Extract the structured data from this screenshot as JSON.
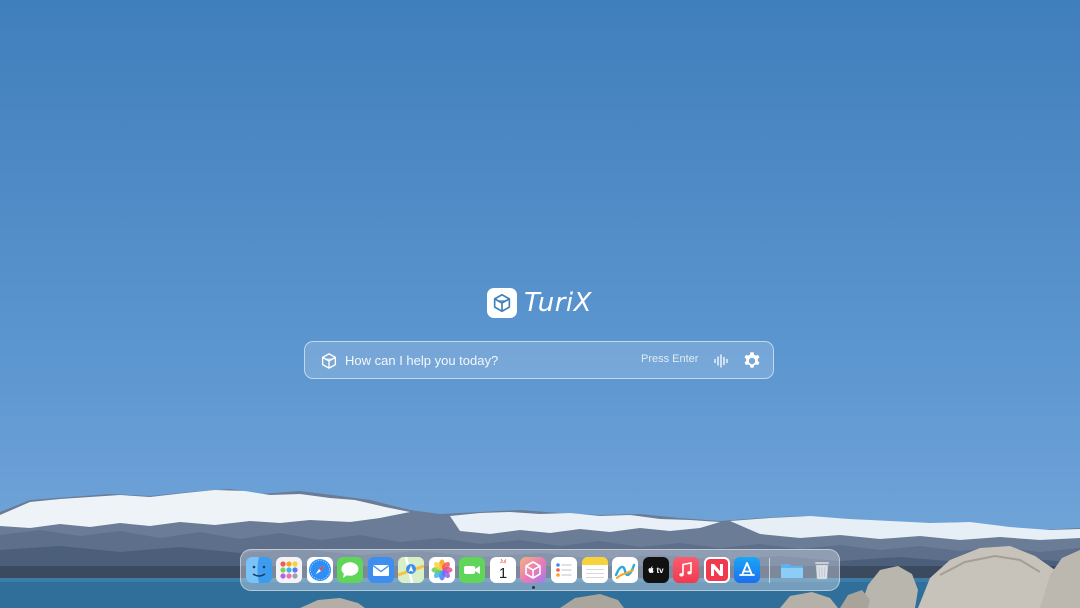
{
  "app": {
    "name": "TuriX"
  },
  "prompt": {
    "placeholder": "How can I help you today?",
    "hint": "Press Enter"
  },
  "dock": {
    "calendar_month": "Jul",
    "calendar_day": "1",
    "appletv_label": "tv",
    "apps": [
      {
        "name": "Finder",
        "icon": "finder-icon"
      },
      {
        "name": "Launchpad",
        "icon": "launchpad-icon"
      },
      {
        "name": "Safari",
        "icon": "safari-icon"
      },
      {
        "name": "Messages",
        "icon": "messages-icon"
      },
      {
        "name": "Mail",
        "icon": "mail-icon"
      },
      {
        "name": "Maps",
        "icon": "maps-icon"
      },
      {
        "name": "Photos",
        "icon": "photos-icon"
      },
      {
        "name": "FaceTime",
        "icon": "facetime-icon"
      },
      {
        "name": "Calendar",
        "icon": "calendar-icon"
      },
      {
        "name": "TuriX",
        "icon": "turix-icon",
        "running": true
      },
      {
        "name": "Reminders",
        "icon": "reminders-icon"
      },
      {
        "name": "Notes",
        "icon": "notes-icon"
      },
      {
        "name": "Freeform",
        "icon": "freeform-icon"
      },
      {
        "name": "Apple TV",
        "icon": "appletv-icon"
      },
      {
        "name": "Music",
        "icon": "music-icon"
      },
      {
        "name": "News",
        "icon": "news-icon"
      },
      {
        "name": "App Store",
        "icon": "appstore-icon"
      },
      {
        "name": "Downloads",
        "icon": "folder-icon"
      },
      {
        "name": "Trash",
        "icon": "trash-icon"
      }
    ]
  },
  "colors": {
    "sky_top": "#3f7fbc",
    "sky_bottom": "#78aadb",
    "water": "#2f6f9a"
  }
}
